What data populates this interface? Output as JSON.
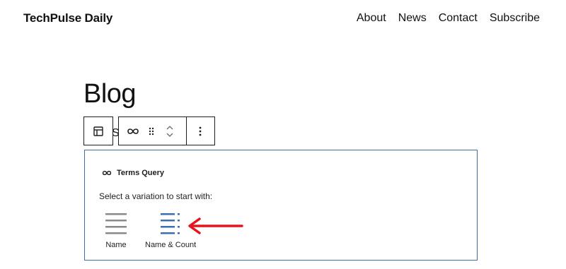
{
  "site": {
    "title": "TechPulse Daily"
  },
  "nav": {
    "items": [
      "About",
      "News",
      "Contact",
      "Subscribe"
    ]
  },
  "page": {
    "heading": "Blog",
    "partial_char": "S"
  },
  "block": {
    "label": "Terms Query",
    "instructions": "Select a variation to start with:",
    "variations": [
      {
        "label": "Name",
        "icon": "list-lines-icon"
      },
      {
        "label": "Name & Count",
        "icon": "list-count-icon"
      }
    ]
  },
  "colors": {
    "accent": "#3f6ea6",
    "arrow": "#e4161b",
    "variation_name_icon": "#8a8a8a",
    "variation_count_icon": "#3b6fb0"
  }
}
